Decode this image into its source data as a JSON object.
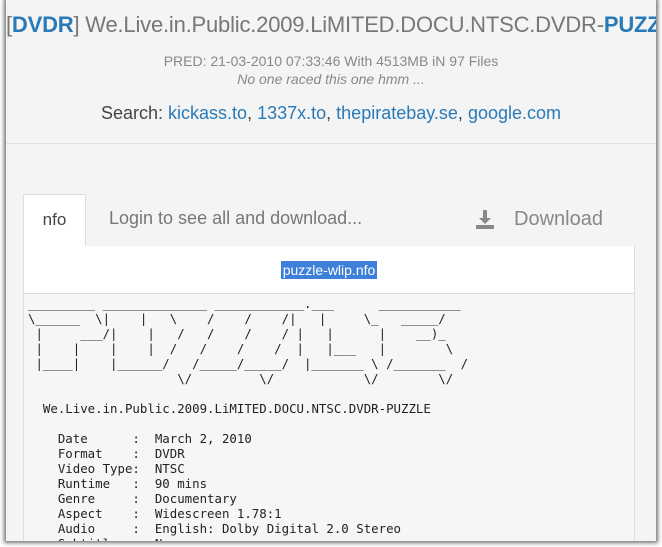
{
  "header": {
    "title_open": "[",
    "category": "DVDR",
    "title_close": "]",
    "release_name": " We.Live.in.Public.2009.LiMITED.DOCU.NTSC.DVDR-",
    "group": "PUZZLE",
    "pred_info": "PRED: 21-03-2010 07:33:46 With 4513MB iN 97 Files",
    "race_note": "No one raced this one hmm ...",
    "search_label": "Search:",
    "search_links": [
      "kickass.to",
      "1337x.to",
      "thepiratebay.se",
      "google.com"
    ]
  },
  "tabs": {
    "nfo_label": "nfo",
    "login_label": "Login to see all and download...",
    "download_label": "Download",
    "download_icon": "download-icon"
  },
  "nfo": {
    "filename": "puzzle-wlip.nfo",
    "content": "_________ ______________ ____________.___      ___________\n\\______  \\|    |   \\    /    /    /|   |     \\_   _____/\n |     ___/|    |   /   /    /    / |   |      |    __)_\n |    |    |    |  /   /    /    /  |   |___   |        \\\n |____|    |______/   /_____/_____/  |_______ \\ /_______  /\n                    \\/         \\/            \\/        \\/\n\n  We.Live.in.Public.2009.LiMITED.DOCU.NTSC.DVDR-PUZZLE\n\n    Date      :  March 2, 2010\n    Format    :  DVDR\n    Video Type:  NTSC\n    Runtime   :  90 mins\n    Genre     :  Documentary\n    Aspect    :  Widescreen 1.78:1\n    Audio     :  English: Dolby Digital 2.0 Stereo\n    Subtitles :  None"
  }
}
